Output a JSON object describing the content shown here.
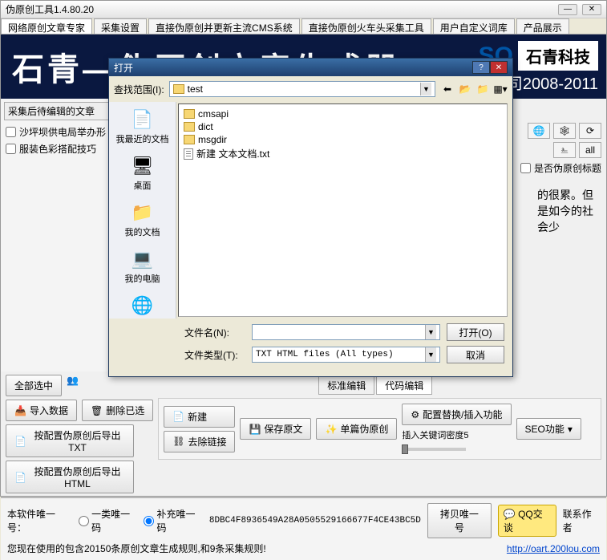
{
  "window": {
    "title": "伪原创工具1.4.80.20"
  },
  "tabs": [
    "网络原创文章专家",
    "采集设置",
    "直接伪原创并更新主流CMS系统",
    "直接伪原创火车头采集工具",
    "用户自定义词库",
    "产品展示"
  ],
  "banner": {
    "big": "石青—伪原创立音生成器",
    "brand": "石青科技",
    "so": "SO",
    "sub": "司2008-2011"
  },
  "left": {
    "group": "采集后待编辑的文章",
    "items": [
      "沙坪坝供电局举办形",
      "服装色彩搭配技巧"
    ]
  },
  "right": {
    "pseudo_title": "是否伪原创标题",
    "snippet": "的很累。但是如今的社会少"
  },
  "mid_btns": {
    "select_all": "全部选中",
    "import": "导入数据",
    "del_sel": "删除已选",
    "export_txt": "按配置伪原创后导出TXT",
    "export_html": "按配置伪原创后导出HTML"
  },
  "inline_tabs": [
    "标准编辑",
    "代码编辑"
  ],
  "editor_tb": {
    "new": "新建",
    "save": "保存原文",
    "pseudo_one": "单篇伪原创",
    "remove_link": "去除链接",
    "config_replace": "配置替换/插入功能",
    "density": "插入关键词密度5",
    "seo": "SEO功能"
  },
  "footer": {
    "label": "本软件唯一号：",
    "r1": "一类唯一码",
    "r2": "补充唯一码",
    "code": "8DBC4F8936549A28A0505529166677F4CE43BC5D",
    "copy": "拷贝唯一号",
    "qq": "QQ交谈",
    "contact": "联系作者",
    "rules": "您现在使用的包含20150条原创文章生成规则,和9条采集规则!",
    "url": "http://oart.200lou.com"
  },
  "dlg": {
    "title": "打开",
    "look_label": "查找范围(I):",
    "path": "test",
    "places": [
      "我最近的文档",
      "桌面",
      "我的文档",
      "我的电脑",
      "网上邻居"
    ],
    "files": [
      {
        "t": "folder",
        "n": "cmsapi"
      },
      {
        "t": "folder",
        "n": "dict"
      },
      {
        "t": "folder",
        "n": "msgdir"
      },
      {
        "t": "txt",
        "n": "新建 文本文档.txt"
      }
    ],
    "fn_label": "文件名(N):",
    "ft_label": "文件类型(T):",
    "ft_value": "TXT HTML files (All types)",
    "open": "打开(O)",
    "cancel": "取消"
  }
}
